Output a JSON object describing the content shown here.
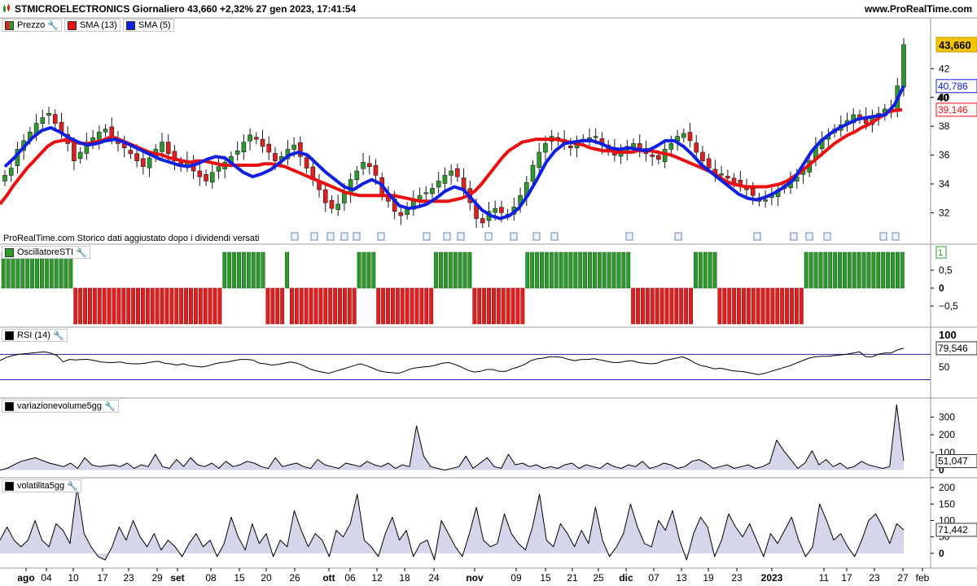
{
  "header": {
    "title": "STMICROELECTRONICS Giornaliero 43,660 +2,32% 27 gen 2023, 17:41:54",
    "site": "www.ProRealTime.com",
    "note": "ProRealTime.com  Storico dati aggiustato dopo i dividendi versati"
  },
  "legends": {
    "price": "Prezzo",
    "sma13": "SMA (13)",
    "sma5": "SMA (5)",
    "osc": "OscillatoreSTI",
    "rsi": "RSI (14)",
    "vol": "variazionevolume5gg",
    "volat": "volatilita5gg"
  },
  "colors": {
    "up": "#2e9a2e",
    "down": "#e02020",
    "sma13": "#e81010",
    "sma5": "#1020e0",
    "area_fill": "#d6d6ea",
    "last_price_bg": "#f5c400"
  },
  "icons": [
    "candlestick-icon",
    "wrench-icon",
    "dividend-icon"
  ],
  "chart_data": [
    {
      "type": "candlestick",
      "title": "STMICROELECTRONICS Giornaliero",
      "series": [
        {
          "name": "Prezzo",
          "close": [
            34.6,
            35.1,
            36.4,
            37.0,
            37.6,
            38.2,
            38.6,
            38.9,
            38.2,
            37.6,
            36.8,
            35.6,
            36.2,
            36.9,
            37.2,
            37.6,
            37.8,
            37.2,
            36.8,
            36.5,
            36.1,
            35.6,
            35.2,
            35.8,
            36.4,
            36.9,
            36.1,
            35.6,
            35.2,
            35.6,
            34.9,
            34.5,
            34.2,
            34.8,
            35.2,
            35.5,
            35.9,
            36.3,
            36.9,
            37.4,
            37.1,
            36.6,
            36.2,
            35.6,
            35.9,
            36.4,
            36.7,
            35.9,
            35.1,
            34.3,
            33.6,
            32.7,
            32.3,
            32.6,
            33.5,
            34.3,
            34.9,
            35.5,
            35.2,
            34.6,
            33.2,
            32.8,
            32.1,
            31.8,
            32.4,
            32.9,
            33.2,
            33.4,
            33.7,
            34.2,
            34.6,
            34.9,
            34.5,
            33.6,
            32.7,
            31.6,
            31.3,
            32.1,
            32.3,
            32.0,
            31.9,
            32.4,
            33.2,
            34.1,
            35.3,
            36.2,
            36.8,
            37.3,
            37.0,
            36.8,
            36.5,
            36.9,
            37.1,
            37.2,
            37.3,
            36.7,
            36.3,
            36.0,
            36.2,
            36.6,
            36.8,
            36.3,
            36.1,
            35.9,
            35.7,
            36.4,
            36.8,
            37.3,
            37.5,
            37.0,
            36.2,
            35.6,
            35.1,
            34.6,
            34.7,
            34.4,
            34.1,
            33.9,
            33.6,
            33.2,
            32.8,
            32.9,
            33.2,
            33.6,
            33.9,
            34.2,
            34.5,
            34.9,
            35.6,
            36.6,
            37.1,
            37.4,
            37.8,
            38.1,
            38.4,
            38.8,
            38.5,
            38.2,
            38.6,
            38.9,
            39.2,
            39.0,
            40.8,
            43.66
          ]
        },
        {
          "name": "SMA (13)",
          "values": [
            32.6,
            33.2,
            33.9,
            34.5,
            35.1,
            35.6,
            36.1,
            36.6,
            36.9,
            37.0,
            37.1,
            36.9,
            36.8,
            36.8,
            36.9,
            37.0,
            37.2,
            37.2,
            37.0,
            36.8,
            36.6,
            36.4,
            36.2,
            36.1,
            36.0,
            35.8,
            35.7,
            35.6,
            35.5,
            35.6,
            35.6,
            35.5,
            35.4,
            35.3,
            35.3,
            35.3,
            35.3,
            35.3,
            35.3,
            35.4,
            35.4,
            35.3,
            35.2,
            35.0,
            34.8,
            34.6,
            34.4,
            34.2,
            34.0,
            33.8,
            33.6,
            33.4,
            33.3,
            33.2,
            33.2,
            33.2,
            33.2,
            33.2,
            33.2,
            33.1,
            33.0,
            32.9,
            32.8,
            32.8,
            32.8,
            32.8,
            32.8,
            32.9,
            33.0,
            33.2,
            33.5,
            34.0,
            34.6,
            35.2,
            35.8,
            36.3,
            36.6,
            36.9,
            37.0,
            37.1,
            37.1,
            37.1,
            37.1,
            37.0,
            36.9,
            36.8,
            36.7,
            36.5,
            36.4,
            36.3,
            36.3,
            36.2,
            36.2,
            36.2,
            36.3,
            36.3,
            36.3,
            36.2,
            36.1,
            36.0,
            35.8,
            35.6,
            35.4,
            35.2,
            35.0,
            34.8,
            34.5,
            34.2,
            34.0,
            33.9,
            33.8,
            33.8,
            33.8,
            33.8,
            33.9,
            34.0,
            34.2,
            34.5,
            34.8,
            35.2,
            35.6,
            36.0,
            36.4,
            36.8,
            37.1,
            37.4,
            37.6,
            37.9,
            38.1,
            38.4,
            38.7,
            39.0,
            39.1,
            39.15
          ]
        },
        {
          "name": "SMA (5)",
          "values": [
            35.2,
            35.8,
            36.5,
            37.2,
            37.7,
            37.9,
            37.6,
            37.2,
            36.9,
            36.7,
            36.8,
            37.0,
            37.1,
            36.9,
            36.6,
            36.3,
            36.0,
            35.7,
            35.5,
            35.3,
            35.2,
            35.4,
            35.7,
            35.9,
            35.8,
            35.3,
            34.8,
            34.5,
            34.7,
            35.0,
            35.5,
            36.0,
            36.2,
            36.0,
            35.4,
            34.8,
            34.3,
            33.8,
            33.6,
            34.0,
            34.3,
            34.0,
            33.2,
            32.5,
            32.3,
            32.4,
            32.6,
            33.0,
            33.5,
            33.8,
            33.6,
            32.9,
            32.2,
            31.8,
            31.6,
            31.8,
            32.3,
            33.2,
            34.3,
            35.5,
            36.3,
            36.8,
            36.9,
            37.0,
            37.0,
            36.8,
            36.5,
            36.4,
            36.5,
            36.4,
            36.3,
            36.6,
            37.0,
            37.0,
            36.6,
            36.0,
            35.3,
            34.8,
            34.3,
            33.8,
            33.3,
            33.0,
            32.9,
            33.1,
            33.4,
            33.8,
            34.3,
            35.3,
            36.3,
            37.0,
            37.5,
            37.9,
            38.2,
            38.5,
            38.6,
            38.7,
            38.8,
            39.5,
            40.786
          ]
        }
      ],
      "y_ticks": [
        32,
        34,
        36,
        38,
        40,
        42
      ],
      "ylim": [
        30.5,
        44.5
      ],
      "last_labels": {
        "price": "43,660",
        "sma5": "40,786",
        "sma13": "39,146"
      }
    },
    {
      "type": "bar",
      "title": "OscillatoreSTI",
      "values_pattern": "1=up, -1=down",
      "values": [
        1,
        1,
        1,
        1,
        1,
        1,
        1,
        1,
        1,
        1,
        1,
        1,
        1,
        1,
        1,
        -1,
        -1,
        -1,
        -1,
        -1,
        -1,
        -1,
        -1,
        -1,
        -1,
        -1,
        -1,
        -1,
        -1,
        -1,
        -1,
        -1,
        -1,
        -1,
        -1,
        -1,
        -1,
        -1,
        -1,
        -1,
        -1,
        -1,
        -1,
        -1,
        -1,
        -1,
        1,
        1,
        1,
        1,
        1,
        1,
        1,
        1,
        1,
        -1,
        -1,
        -1,
        -1,
        1,
        -1,
        -1,
        -1,
        -1,
        -1,
        -1,
        -1,
        -1,
        -1,
        -1,
        -1,
        -1,
        -1,
        -1,
        1,
        1,
        1,
        1,
        -1,
        -1,
        -1,
        -1,
        -1,
        -1,
        -1,
        -1,
        -1,
        -1,
        -1,
        -1,
        1,
        1,
        1,
        1,
        1,
        1,
        1,
        1,
        -1,
        -1,
        -1,
        -1,
        -1,
        -1,
        -1,
        -1,
        -1,
        -1,
        -1,
        1,
        1,
        1,
        1,
        1,
        1,
        1,
        1,
        1,
        1,
        1,
        1,
        1,
        1,
        1,
        1,
        1,
        1,
        1,
        1,
        1,
        1,
        -1,
        -1,
        -1,
        -1,
        -1,
        -1,
        -1,
        -1,
        -1,
        -1,
        -1,
        -1,
        -1,
        1,
        1,
        1,
        1,
        1,
        -1,
        -1,
        -1,
        -1,
        -1,
        -1,
        -1,
        -1,
        -1,
        -1,
        -1,
        -1,
        -1,
        -1,
        -1,
        -1,
        -1,
        -1,
        1,
        1,
        1,
        1,
        1,
        1,
        1,
        1,
        1,
        1,
        1,
        1,
        1,
        1,
        1,
        1,
        1,
        1,
        1,
        1,
        1
      ],
      "y_ticks": [
        "1",
        "0,5",
        "0",
        "−0,5"
      ],
      "last_label": "1"
    },
    {
      "type": "line",
      "title": "RSI (14)",
      "values": [
        60,
        65,
        68,
        70,
        71,
        72,
        73,
        74,
        72,
        68,
        58,
        62,
        61,
        62,
        62,
        60,
        58,
        57,
        57,
        58,
        56,
        55,
        55,
        56,
        58,
        59,
        56,
        55,
        53,
        55,
        52,
        51,
        50,
        52,
        55,
        57,
        58,
        60,
        62,
        62,
        61,
        56,
        55,
        53,
        54,
        56,
        58,
        56,
        52,
        47,
        44,
        42,
        40,
        43,
        46,
        49,
        52,
        55,
        52,
        48,
        44,
        42,
        41,
        40,
        43,
        47,
        49,
        50,
        51,
        53,
        56,
        57,
        54,
        50,
        45,
        42,
        43,
        46,
        46,
        43,
        43,
        47,
        50,
        54,
        60,
        63,
        64,
        66,
        66,
        65,
        62,
        60,
        62,
        62,
        63,
        61,
        59,
        57,
        57,
        59,
        60,
        57,
        56,
        55,
        56,
        60,
        62,
        64,
        66,
        62,
        56,
        52,
        50,
        47,
        48,
        46,
        44,
        43,
        42,
        40,
        38,
        40,
        43,
        46,
        49,
        52,
        56,
        60,
        64,
        66,
        67,
        67,
        68,
        69,
        70,
        72,
        74,
        66,
        66,
        70,
        72,
        72,
        77,
        79.546
      ],
      "y_ticks": [
        50,
        100
      ],
      "levels": [
        30,
        70
      ],
      "last_label": "79,546"
    },
    {
      "type": "area",
      "title": "variazionevolume5gg",
      "values": [
        0,
        10,
        30,
        50,
        60,
        70,
        55,
        40,
        30,
        20,
        40,
        10,
        70,
        30,
        20,
        25,
        30,
        20,
        40,
        10,
        30,
        20,
        90,
        20,
        10,
        60,
        20,
        70,
        30,
        20,
        40,
        10,
        50,
        20,
        30,
        50,
        40,
        20,
        10,
        70,
        20,
        30,
        40,
        20,
        10,
        60,
        30,
        20,
        10,
        40,
        30,
        20,
        50,
        30,
        20,
        40,
        10,
        30,
        20,
        250,
        80,
        20,
        10,
        0,
        10,
        20,
        80,
        10,
        40,
        70,
        20,
        10,
        90,
        30,
        40,
        20,
        30,
        10,
        20,
        10,
        30,
        40,
        10,
        30,
        20,
        10,
        40,
        20,
        10,
        30,
        20,
        50,
        10,
        20,
        40,
        30,
        10,
        20,
        50,
        60,
        40,
        10,
        20,
        30,
        10,
        20,
        30,
        10,
        20,
        40,
        170,
        110,
        60,
        10,
        40,
        110,
        30,
        60,
        20,
        40,
        10,
        20,
        50,
        30,
        20,
        10,
        20,
        370,
        51.047
      ],
      "y_ticks": [
        0,
        100,
        200,
        300
      ],
      "last_label": "51,047"
    },
    {
      "type": "area",
      "title": "volatilita5gg",
      "values": [
        40,
        80,
        40,
        20,
        40,
        100,
        40,
        20,
        90,
        70,
        30,
        200,
        60,
        20,
        -10,
        -20,
        20,
        80,
        40,
        100,
        50,
        20,
        60,
        10,
        40,
        20,
        -10,
        30,
        60,
        20,
        40,
        -10,
        30,
        110,
        50,
        10,
        90,
        30,
        60,
        -10,
        40,
        20,
        130,
        70,
        20,
        60,
        40,
        -10,
        70,
        50,
        90,
        180,
        40,
        20,
        -10,
        60,
        110,
        40,
        70,
        -10,
        30,
        40,
        -20,
        100,
        60,
        20,
        -10,
        60,
        140,
        40,
        20,
        30,
        120,
        60,
        30,
        10,
        80,
        180,
        40,
        20,
        90,
        60,
        20,
        70,
        30,
        140,
        40,
        -10,
        20,
        60,
        150,
        80,
        30,
        20,
        100,
        70,
        130,
        40,
        -20,
        60,
        110,
        80,
        -10,
        40,
        120,
        80,
        50,
        90,
        40,
        -10,
        60,
        30,
        70,
        110,
        40,
        -10,
        20,
        150,
        100,
        40,
        60,
        20,
        -10,
        40,
        100,
        120,
        80,
        30,
        90,
        71.442
      ],
      "y_ticks": [
        0,
        50,
        100,
        150,
        200
      ],
      "last_label": "71,442"
    }
  ],
  "x_axis": {
    "labels": [
      "ago",
      "04",
      "10",
      "17",
      "23",
      "29",
      "set",
      "08",
      "15",
      "20",
      "26",
      "ott",
      "06",
      "12",
      "18",
      "24",
      "nov",
      "09",
      "15",
      "21",
      "25",
      "dic",
      "07",
      "13",
      "19",
      "23",
      "2023",
      "11",
      "17",
      "23",
      "27",
      "feb"
    ],
    "bold": [
      "ago",
      "set",
      "ott",
      "nov",
      "dic",
      "2023"
    ]
  }
}
